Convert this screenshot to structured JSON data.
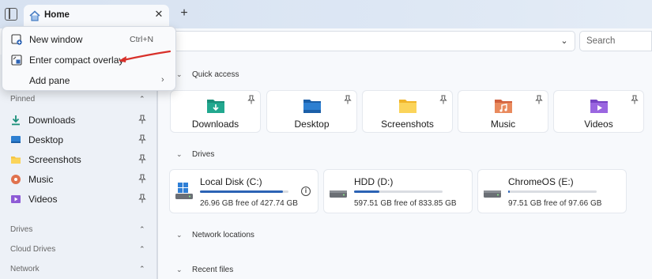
{
  "tabs": [
    {
      "label": "Home",
      "icon": "home-icon"
    }
  ],
  "new_tab_symbol": "+",
  "tab_close_symbol": "✕",
  "search": {
    "placeholder": "Search"
  },
  "menu": {
    "items": [
      {
        "label": "New window",
        "shortcut": "Ctrl+N",
        "icon": "new-window-icon"
      },
      {
        "label": "Enter compact overlay",
        "icon": "compact-overlay-icon"
      },
      {
        "label": "Add pane",
        "icon": "none",
        "chevron": "›"
      }
    ]
  },
  "sidebar": {
    "pinned_label": "Pinned",
    "pinned_items": [
      {
        "label": "Downloads",
        "icon": "download-icon"
      },
      {
        "label": "Desktop",
        "icon": "desktop-icon"
      },
      {
        "label": "Screenshots",
        "icon": "folder-icon"
      },
      {
        "label": "Music",
        "icon": "music-icon"
      },
      {
        "label": "Videos",
        "icon": "video-icon"
      }
    ],
    "sections": [
      {
        "label": "Drives"
      },
      {
        "label": "Cloud Drives"
      },
      {
        "label": "Network"
      }
    ]
  },
  "main": {
    "quick_access": {
      "title": "Quick access",
      "items": [
        {
          "label": "Downloads",
          "icon": "download-folder-icon"
        },
        {
          "label": "Desktop",
          "icon": "desktop-folder-icon"
        },
        {
          "label": "Screenshots",
          "icon": "folder-icon"
        },
        {
          "label": "Music",
          "icon": "music-folder-icon"
        },
        {
          "label": "Videos",
          "icon": "video-folder-icon"
        }
      ]
    },
    "drives": {
      "title": "Drives",
      "items": [
        {
          "name": "Local Disk (C:)",
          "free_text": "26.96 GB free of 427.74 GB",
          "used_fraction": 0.937,
          "icon": "windows-drive-icon",
          "info_symbol": "i"
        },
        {
          "name": "HDD (D:)",
          "free_text": "597.51 GB free of 833.85 GB",
          "used_fraction": 0.283,
          "icon": "hard-drive-icon"
        },
        {
          "name": "ChromeOS (E:)",
          "free_text": "97.51 GB free of 97.66 GB",
          "used_fraction": 0.0015,
          "icon": "hard-drive-icon"
        }
      ]
    },
    "network_locations": {
      "title": "Network locations"
    },
    "recent_files": {
      "title": "Recent files"
    }
  },
  "colors": {
    "accent": "#2c63b5",
    "annotation_arrow": "#d8302a"
  }
}
